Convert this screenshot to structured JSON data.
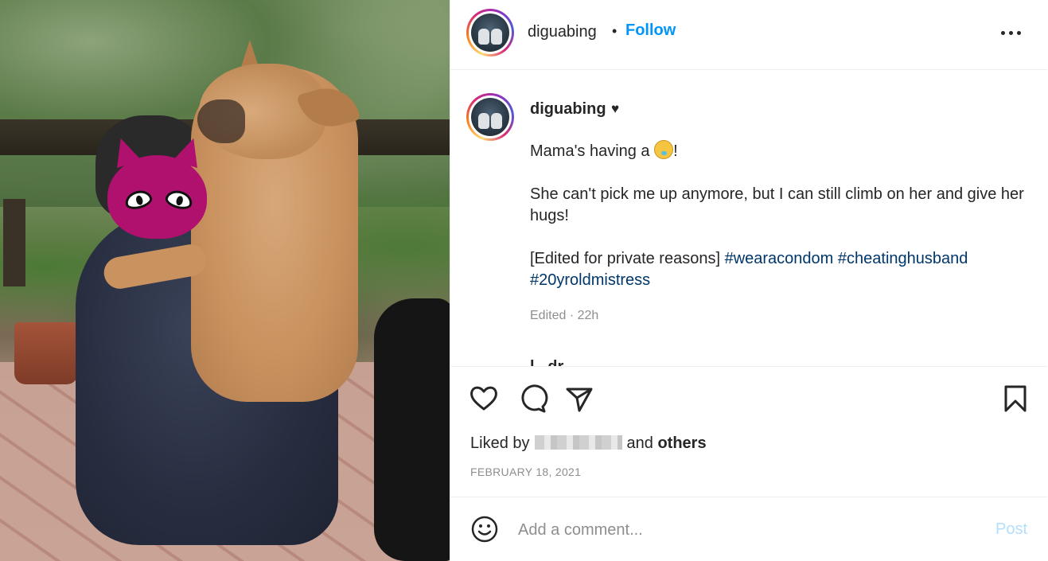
{
  "post": {
    "username": "diguabing",
    "follow_label": "Follow",
    "separator": "•"
  },
  "caption": {
    "username": "diguabing",
    "badge": "♥",
    "line1_text": "Mama's having a ",
    "line1_end": "!",
    "line2": "She can't pick me up anymore, but I can still climb on her and give her hugs!",
    "line3_text": "[Edited for private reasons] ",
    "tags": [
      "#wearacondom",
      "#cheatinghusband",
      "#20yroldmistress"
    ],
    "meta": "Edited · 22h"
  },
  "next_comment": {
    "username": "l...dr"
  },
  "likes": {
    "prefix": "Liked by",
    "middle": "and",
    "others": "others"
  },
  "date": "FEBRUARY 18, 2021",
  "comment_input": {
    "placeholder": "Add a comment...",
    "post_label": "Post"
  },
  "icons": {
    "like": "heart-icon",
    "comment": "comment-icon",
    "share": "share-icon",
    "save": "bookmark-icon",
    "emoji": "smiley-icon",
    "more": "more-options-icon"
  },
  "colors": {
    "accent": "#0095f6",
    "hashtag": "#00376b",
    "post_disabled": "#b2dffc",
    "muted": "#8e8e8e"
  }
}
